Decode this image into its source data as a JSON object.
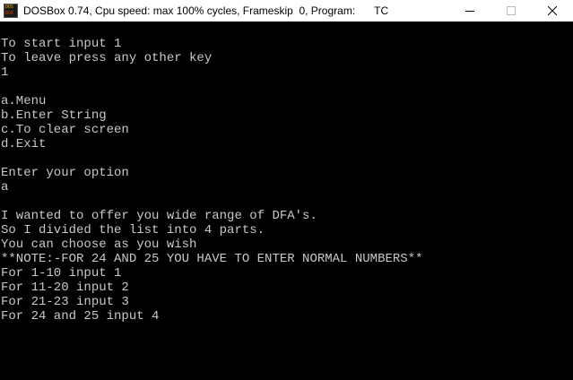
{
  "window": {
    "title": "DOSBox 0.74, Cpu speed: max 100% cycles, Frameskip  0, Program:",
    "program": "TC",
    "icon": "dosbox-icon",
    "icon_text_top": "DOS",
    "icon_text_bottom": "BOX",
    "controls": [
      "minimize-icon",
      "maximize-icon",
      "close-icon"
    ]
  },
  "terminal": {
    "text_color": "#c8c8c8",
    "background": "#000000",
    "lines": [
      "To start input 1",
      "To leave press any other key",
      "1",
      "",
      "a.Menu",
      "b.Enter String",
      "c.To clear screen",
      "d.Exit",
      "",
      "Enter your option",
      "a",
      "",
      "I wanted to offer you wide range of DFA's.",
      "So I divided the list into 4 parts.",
      "You can choose as you wish",
      "**NOTE:-FOR 24 AND 25 YOU HAVE TO ENTER NORMAL NUMBERS**",
      "For 1-10 input 1",
      "For 11-20 input 2",
      "For 21-23 input 3",
      "For 24 and 25 input 4"
    ]
  }
}
